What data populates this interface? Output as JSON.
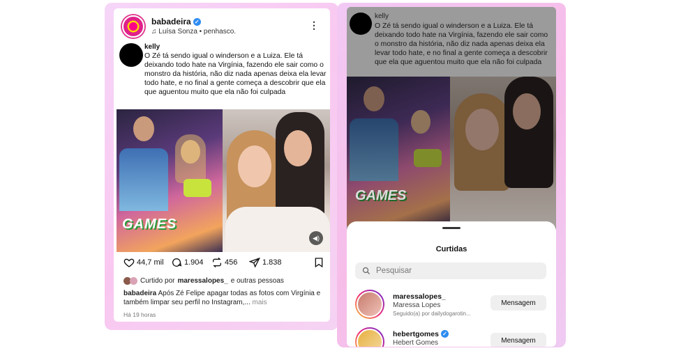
{
  "post": {
    "username": "babadeira",
    "music": "Luísa Sonza • penhasco.",
    "comment_user": "kelly",
    "comment_text": "O Zé tá sendo igual o winderson e a Luiza. Ele tá deixando todo hate na Virgínia, fazendo ele sair como o monstro da história, não diz nada apenas deixa ela levar todo hate, e no final a gente começa a descobrir que ela que aguentou muito que ela não foi culpada",
    "games_logo": "GAMES",
    "likes": "44,7 mil",
    "comments": "1.904",
    "reposts": "456",
    "shares": "1.838",
    "liked_prefix": "Curtido por",
    "liked_user": "maressalopes_",
    "liked_suffix": "e outras pessoas",
    "caption_user": "babadeira",
    "caption_text": "Após Zé Felipe apagar todas as fotos com Virgínia e também limpar seu perfil no Instagram,...",
    "caption_more": "mais",
    "time_ago": "Há 19 horas"
  },
  "likes_sheet": {
    "title": "Curtidas",
    "search_placeholder": "Pesquisar",
    "users": [
      {
        "username": "maressalopes_",
        "full_name": "Maressa Lopes",
        "subtitle": "Seguido(a) por dailydogarotin...",
        "button": "Mensagem",
        "verified": false
      },
      {
        "username": "hebertgomes",
        "full_name": "Hebert Gomes",
        "subtitle": "",
        "button": "Mensagem",
        "verified": true
      }
    ]
  },
  "colors": {
    "verified_blue": "#2e8cf0",
    "glow_pink": "#f7bde9"
  },
  "icons": [
    "music-note-icon",
    "more-options-icon",
    "heart-icon",
    "comment-icon",
    "repost-icon",
    "share-icon",
    "bookmark-icon",
    "sound-icon",
    "search-icon",
    "verified-badge-icon"
  ]
}
